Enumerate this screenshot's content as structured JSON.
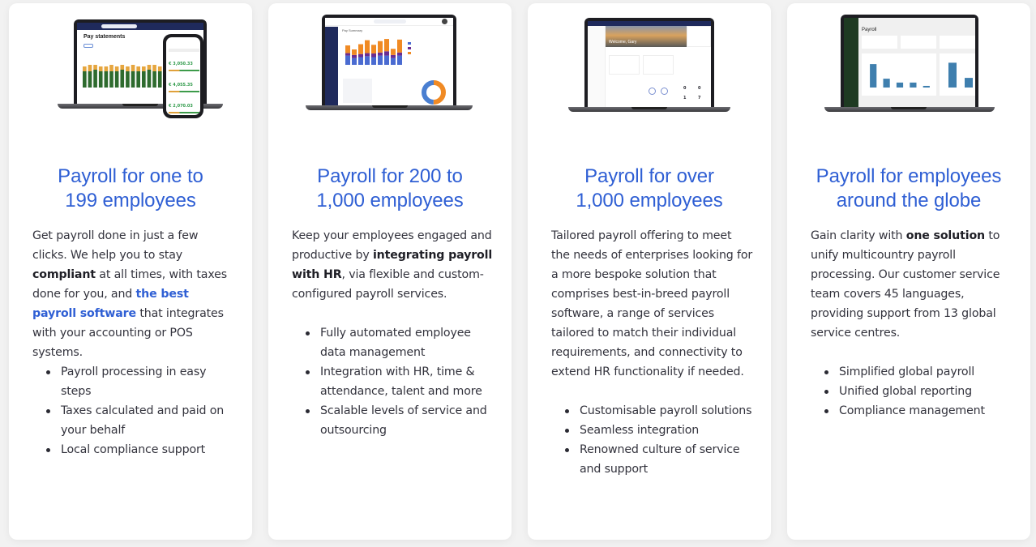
{
  "colors": {
    "accent": "#2f5fd4",
    "page_background": "#f2f2f2",
    "card_background": "#ffffff",
    "text": "#33333d"
  },
  "cards": [
    {
      "title_line1": "Payroll for one to",
      "title_line2": "199 employees",
      "hero": {
        "type": "laptop-and-phone",
        "screen_title": "Pay statements",
        "phone_amounts": [
          "€ 3,050.33",
          "€ 4,055.35",
          "€ 2,070.03"
        ]
      },
      "body": [
        {
          "text": "Get payroll done in just a few clicks. We help you to stay "
        },
        {
          "text": "compliant",
          "style": "bold"
        },
        {
          "text": " at all times, with taxes done for you, and "
        },
        {
          "text": "the best payroll software",
          "style": "link"
        },
        {
          "text": " that integrates with your accounting or POS systems."
        }
      ],
      "bullets": [
        "Payroll processing in easy steps",
        "Taxes calculated and paid on your behalf",
        "Local compliance support"
      ]
    },
    {
      "title_line1": "Payroll for 200 to",
      "title_line2": "1,000 employees",
      "hero": {
        "type": "laptop",
        "screen_title": "Pay Summary",
        "bar_chart": {
          "stack1": [
            0.3,
            0.22,
            0.25,
            0.28,
            0.25,
            0.3,
            0.3,
            0.22,
            0.3
          ],
          "stack2": [
            0.08,
            0.1,
            0.1,
            0.1,
            0.12,
            0.1,
            0.14,
            0.1,
            0.1
          ],
          "stack3": [
            0.25,
            0.18,
            0.32,
            0.42,
            0.28,
            0.37,
            0.4,
            0.2,
            0.42
          ]
        },
        "donut_split": [
          0.5,
          0.5
        ]
      },
      "body": [
        {
          "text": "Keep your employees engaged and productive by "
        },
        {
          "text": "integrating payroll with HR",
          "style": "bold"
        },
        {
          "text": ", via flexible and custom-configured payroll services."
        }
      ],
      "bullets": [
        "Fully automated employee data management",
        "Integration with HR, time & attendance, talent and more",
        "Scalable levels of service and outsourcing"
      ]
    },
    {
      "title_line1": "Payroll for over",
      "title_line2": "1,000 employees",
      "hero": {
        "type": "laptop",
        "screen_title": "Welcome, Gary",
        "counts": [
          "0",
          "0",
          "1",
          "7"
        ]
      },
      "body": [
        {
          "text": "Tailored payroll offering to meet the needs of enterprises looking for a more bespoke solution that comprises best-in-breed payroll software, a range of services tailored to match their individual requirements, and connectivity to extend HR functionality if needed."
        }
      ],
      "bullets": [
        "Customisable payroll solutions",
        "Seamless integration",
        "Renowned culture of service and support"
      ]
    },
    {
      "title_line1": "Payroll for employees",
      "title_line2": "around the globe",
      "hero": {
        "type": "laptop",
        "screen_title": "Payroll",
        "bars_left": [
          0.85,
          0.32,
          0.18,
          0.18,
          0.06
        ],
        "bars_right": [
          0.9,
          0.35
        ]
      },
      "body": [
        {
          "text": "Gain clarity with "
        },
        {
          "text": "one solution",
          "style": "bold"
        },
        {
          "text": " to unify multicountry payroll processing. Our customer service team covers 45 languages, providing support from 13 global service centres."
        }
      ],
      "bullets": [
        "Simplified global payroll",
        "Unified global reporting",
        "Compliance management"
      ]
    }
  ]
}
